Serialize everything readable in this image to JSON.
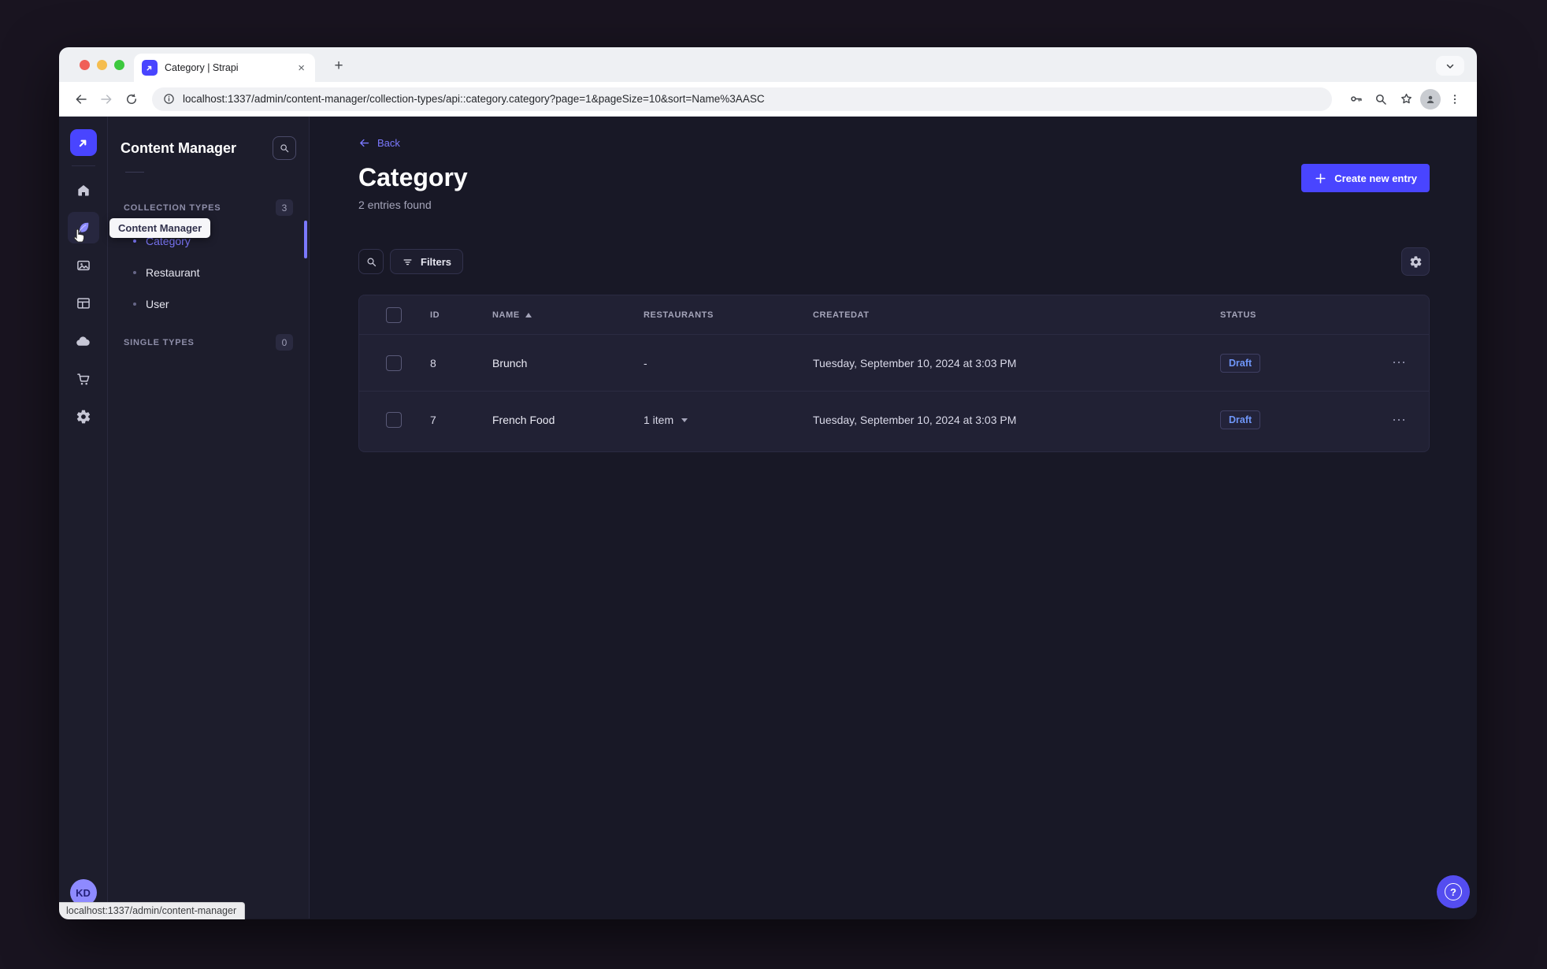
{
  "browser": {
    "tab_title": "Category | Strapi",
    "url": "localhost:1337/admin/content-manager/collection-types/api::category.category?page=1&pageSize=10&sort=Name%3AASC",
    "status_bar_text": "localhost:1337/admin/content-manager"
  },
  "icons": {
    "close": "×",
    "plus": "+",
    "overflow": "⋯"
  },
  "colors": {
    "primary": "#4945ff",
    "link": "#7b79ff",
    "draft_text": "#6f96f9",
    "app_background": "#181826",
    "surface": "#212134"
  },
  "sidebar": {
    "tooltip": "Content Manager",
    "items": [
      "home",
      "content-manager",
      "media-library",
      "content-type-builder",
      "cloud",
      "marketplace",
      "settings"
    ],
    "avatar_initials": "KD"
  },
  "subnav": {
    "title": "Content Manager",
    "sections": [
      {
        "label": "COLLECTION TYPES",
        "badge": "3"
      },
      {
        "label": "SINGLE TYPES",
        "badge": "0"
      }
    ],
    "collection_items": [
      "Category",
      "Restaurant",
      "User"
    ]
  },
  "page": {
    "back_label": "Back",
    "title": "Category",
    "subtitle": "2 entries found",
    "create_button_label": "Create new entry",
    "filters_button_label": "Filters"
  },
  "table": {
    "columns": [
      "ID",
      "NAME",
      "RESTAURANTS",
      "CREATEDAT",
      "STATUS"
    ],
    "rows": [
      {
        "id": "8",
        "name": "Brunch",
        "restaurants": "-",
        "createdat": "Tuesday, September 10, 2024 at 3:03 PM",
        "status": "Draft"
      },
      {
        "id": "7",
        "name": "French Food",
        "restaurants": "1 item",
        "createdat": "Tuesday, September 10, 2024 at 3:03 PM",
        "status": "Draft"
      }
    ]
  },
  "help": {
    "label": "?"
  }
}
